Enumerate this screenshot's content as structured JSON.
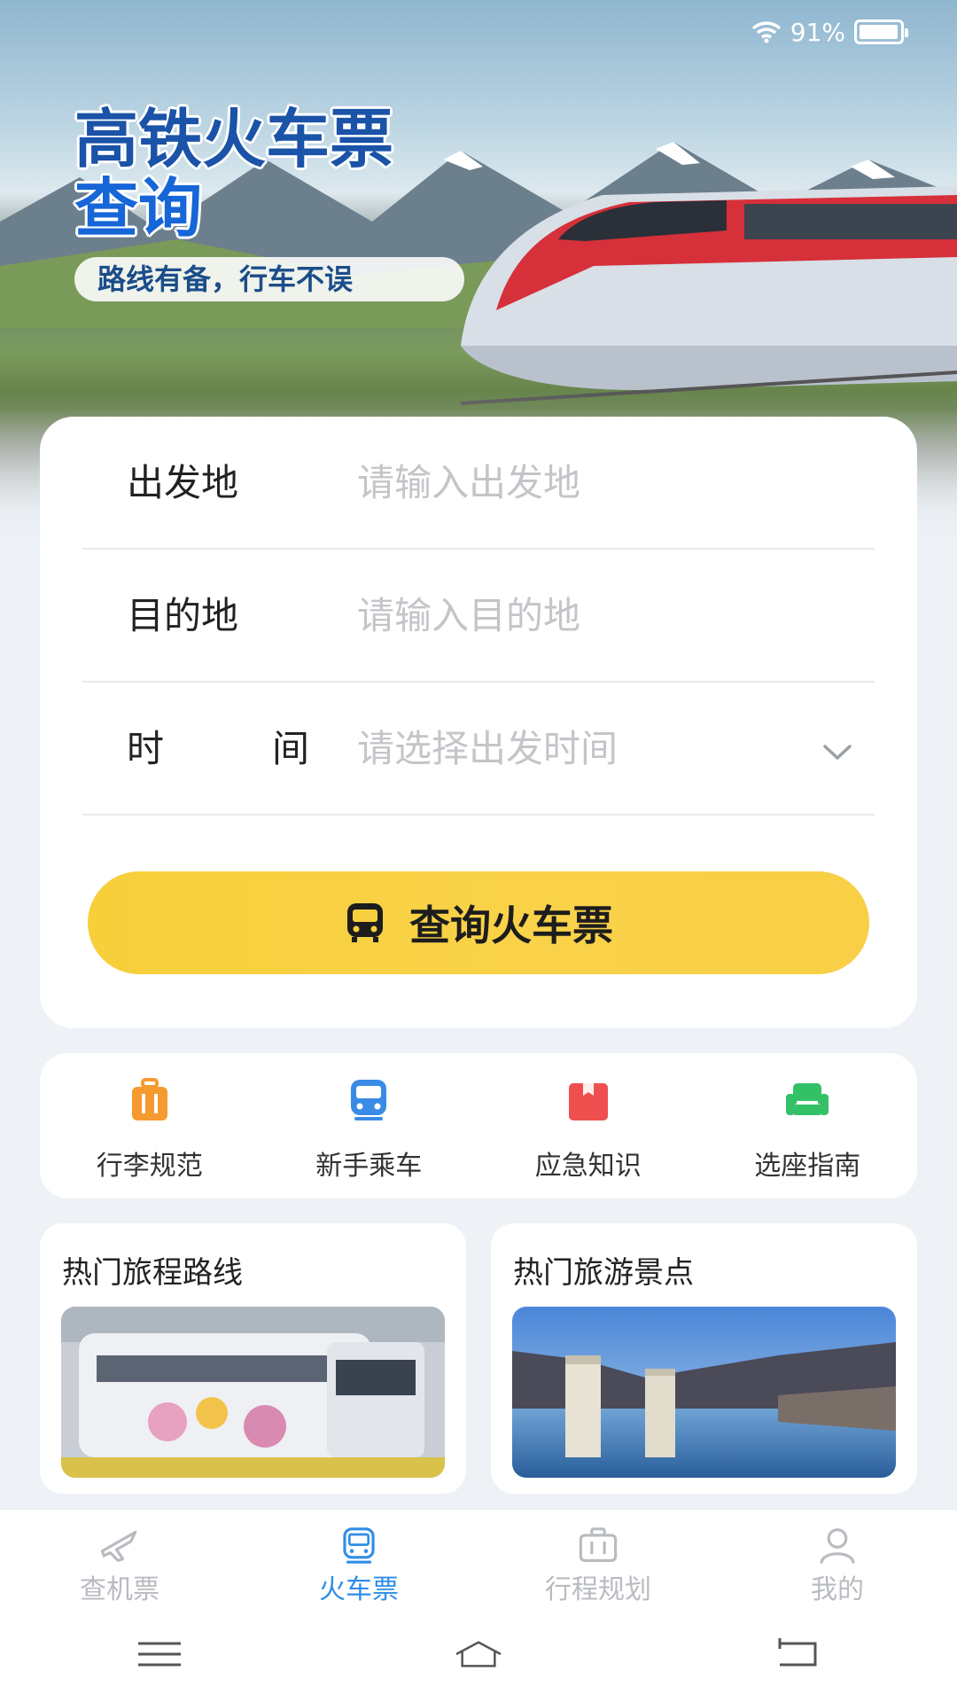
{
  "status_bar": {
    "battery": "91%",
    "wifi_icon": "wifi-icon",
    "battery_icon": "battery-icon"
  },
  "hero": {
    "title_line1": "高铁火车票",
    "title_line2": "查询",
    "subtitle": "路线有备，行车不误"
  },
  "search": {
    "departure": {
      "label": "出发地",
      "placeholder": "请输入出发地"
    },
    "destination": {
      "label": "目的地",
      "placeholder": "请输入目的地"
    },
    "time": {
      "label_char1": "时",
      "label_char2": "间",
      "placeholder": "请选择出发时间"
    },
    "submit_label": "查询火车票"
  },
  "quick_menu": [
    {
      "label": "行李规范",
      "icon": "luggage-icon",
      "color": "#f59a2f"
    },
    {
      "label": "新手乘车",
      "icon": "train-icon",
      "color": "#3a8be6"
    },
    {
      "label": "应急知识",
      "icon": "first-aid-box-icon",
      "color": "#ef4f4f"
    },
    {
      "label": "选座指南",
      "icon": "seat-icon",
      "color": "#34c067"
    }
  ],
  "features": [
    {
      "title": "热门旅程路线"
    },
    {
      "title": "热门旅游景点"
    }
  ],
  "tabbar": [
    {
      "label": "查机票",
      "icon": "airplane-icon",
      "active": false
    },
    {
      "label": "火车票",
      "icon": "train-icon",
      "active": true
    },
    {
      "label": "行程规划",
      "icon": "briefcase-icon",
      "active": false
    },
    {
      "label": "我的",
      "icon": "user-icon",
      "active": false
    }
  ],
  "colors": {
    "accent": "#2f8ee6",
    "button": "#f8cf3f",
    "title_blue": "#1a53a8"
  }
}
